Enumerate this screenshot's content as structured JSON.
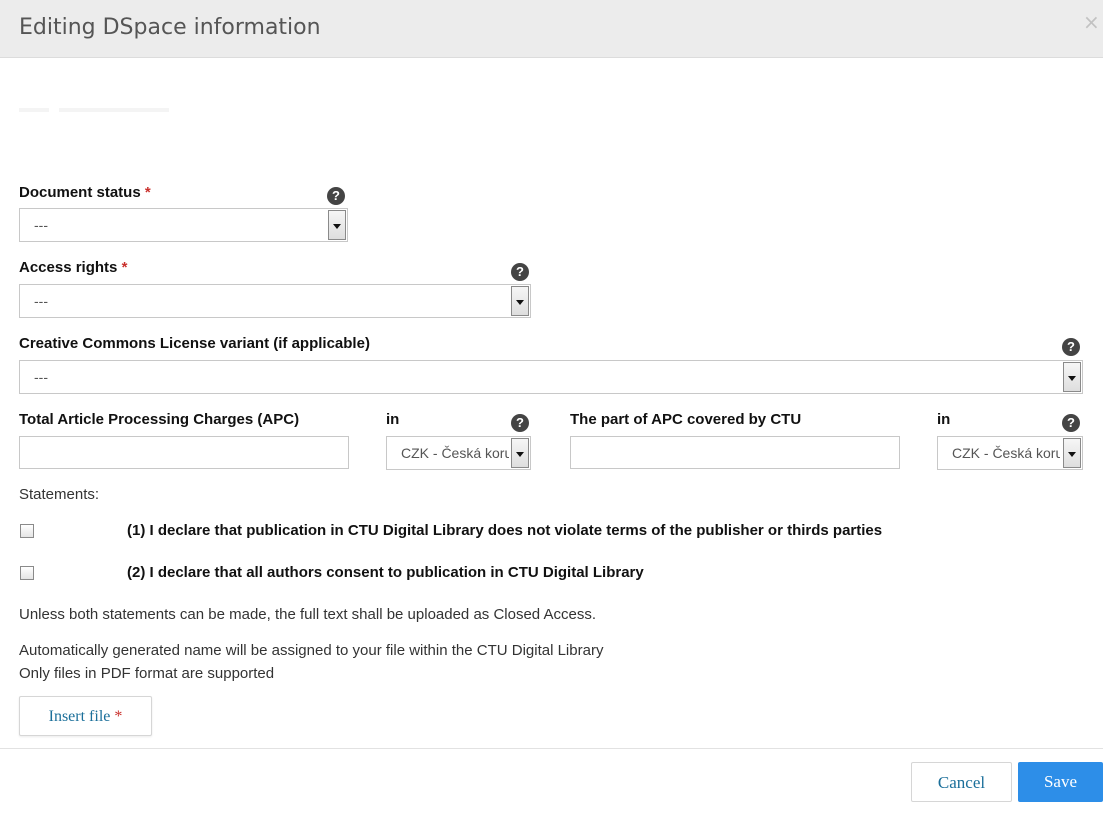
{
  "dialog": {
    "title": "Editing DSpace information",
    "close_glyph": "×"
  },
  "form": {
    "document_status": {
      "label": "Document status",
      "required_mark": "*",
      "value": "---",
      "help_glyph": "?"
    },
    "access_rights": {
      "label": "Access rights",
      "required_mark": "*",
      "value": "---",
      "help_glyph": "?"
    },
    "cc_license": {
      "label": "Creative Commons License variant (if applicable)",
      "value": "---",
      "help_glyph": "?"
    },
    "apc_total": {
      "label": "Total Article Processing Charges (APC)",
      "value": ""
    },
    "apc_total_currency": {
      "label": "in",
      "value": "CZK - Česká koruna",
      "help_glyph": "?"
    },
    "apc_ctu": {
      "label": "The part of APC covered by CTU",
      "value": ""
    },
    "apc_ctu_currency": {
      "label": "in",
      "value": "CZK - Česká koruna",
      "help_glyph": "?"
    }
  },
  "statements": {
    "heading": "Statements:",
    "items": [
      {
        "text": "(1) I declare that publication in CTU Digital Library does not violate terms of the publisher or thirds parties",
        "checked": false
      },
      {
        "text": "(2) I declare that all authors consent to publication in CTU Digital Library",
        "checked": false
      }
    ],
    "note": "Unless both statements can be made, the full text shall be uploaded as Closed Access."
  },
  "file_info": {
    "line1": "Automatically generated name will be assigned to your file within the CTU Digital Library",
    "line2": "Only files in PDF format are supported"
  },
  "buttons": {
    "insert_file": "Insert file",
    "insert_file_required": "*",
    "cancel": "Cancel",
    "save": "Save"
  },
  "icons": {
    "help": "question-circle-icon",
    "close": "close-icon",
    "dropdown": "chevron-down-icon",
    "checkbox": "checkbox-icon"
  },
  "colors": {
    "header_bg": "#ececec",
    "required": "#c9302c",
    "link": "#1b6f9a",
    "primary": "#2d8ee8"
  }
}
